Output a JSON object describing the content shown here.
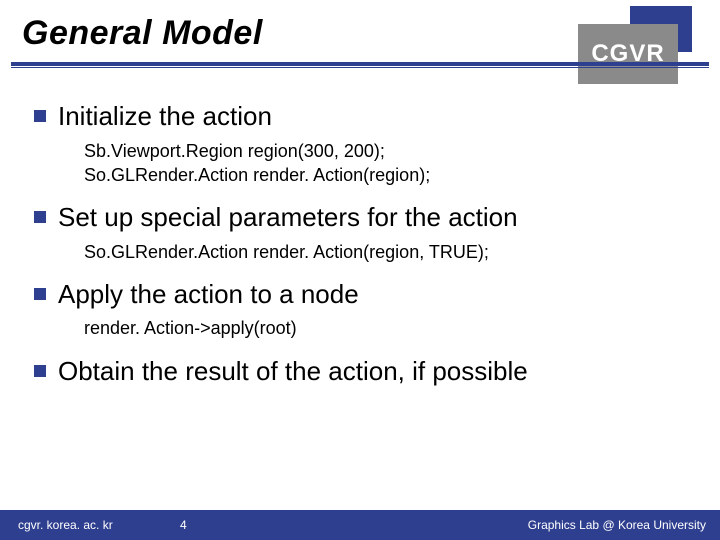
{
  "header": {
    "title": "General Model",
    "badge": "CGVR"
  },
  "content": {
    "items": [
      {
        "text": "Initialize the action",
        "sub": [
          "Sb.Viewport.Region region(300, 200);",
          "So.GLRender.Action render. Action(region);"
        ]
      },
      {
        "text": "Set up special parameters for the action",
        "sub": [
          "So.GLRender.Action render. Action(region, TRUE);"
        ]
      },
      {
        "text": "Apply the action to a node",
        "sub": [
          "render. Action->apply(root)"
        ]
      },
      {
        "text": "Obtain the result of the action, if possible",
        "sub": []
      }
    ]
  },
  "footer": {
    "left": "cgvr. korea. ac. kr",
    "page": "4",
    "right": "Graphics Lab @ Korea University"
  }
}
